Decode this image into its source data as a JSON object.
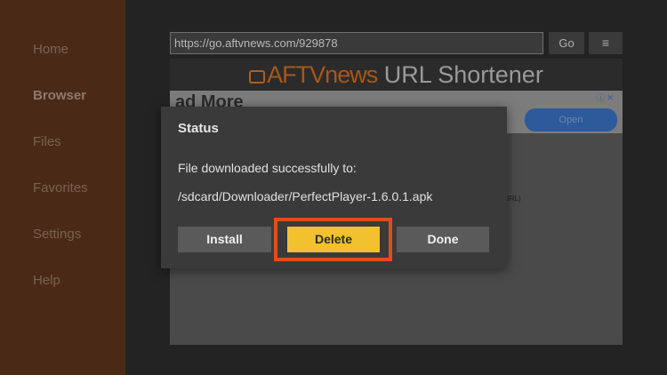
{
  "sidebar": {
    "items": [
      {
        "label": "Home"
      },
      {
        "label": "Browser"
      },
      {
        "label": "Files"
      },
      {
        "label": "Favorites"
      },
      {
        "label": "Settings"
      },
      {
        "label": "Help"
      }
    ],
    "active": "Browser"
  },
  "browser": {
    "url": "https://go.aftvnews.com/929878",
    "go_label": "Go",
    "menu_icon": "≡"
  },
  "webpage": {
    "title_brand": "AFTVnews",
    "title_rest": " URL Shortener",
    "ad_text": "ad More",
    "ad_open_label": "Open",
    "ad_corner_icon": "ⓘ ✕",
    "fragment_text": "URL)"
  },
  "dialog": {
    "title": "Status",
    "message": "File downloaded successfully to:",
    "path": "/sdcard/Downloader/PerfectPlayer-1.6.0.1.apk",
    "buttons": {
      "install": "Install",
      "delete": "Delete",
      "done": "Done"
    }
  },
  "colors": {
    "sidebar": "#4a2a17",
    "accent": "#f2c12e",
    "highlight": "#e44b1e"
  }
}
